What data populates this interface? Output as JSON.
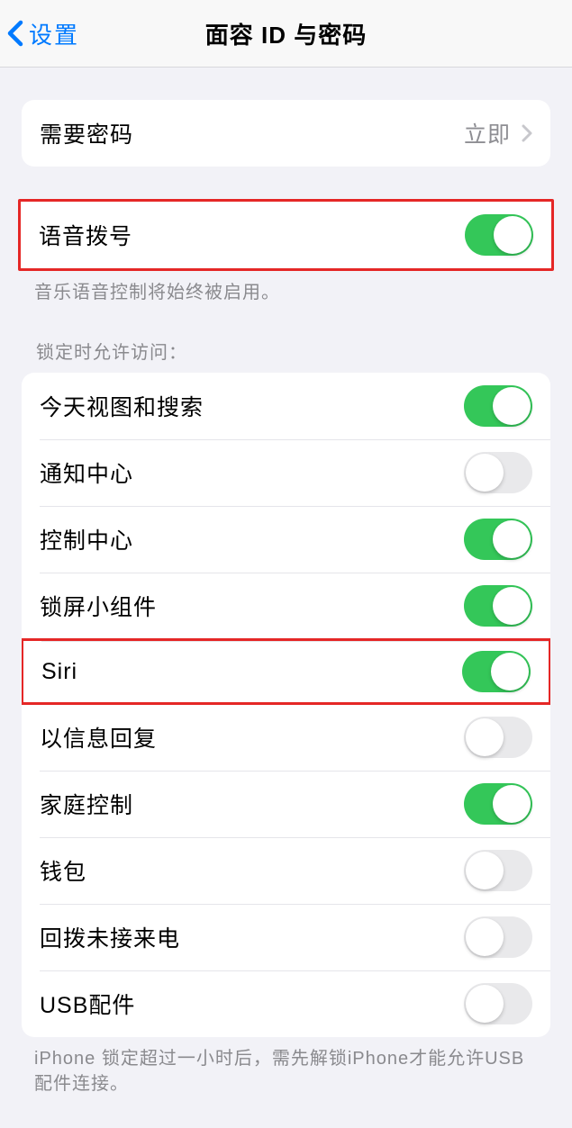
{
  "header": {
    "back_label": "设置",
    "title": "面容 ID 与密码"
  },
  "passcode_group": {
    "require_label": "需要密码",
    "require_value": "立即"
  },
  "voice_dial": {
    "label": "语音拨号",
    "on": true,
    "footer": "音乐语音控制将始终被启用。"
  },
  "lock_section": {
    "header": "锁定时允许访问：",
    "items": [
      {
        "label": "今天视图和搜索",
        "on": true,
        "highlighted": false
      },
      {
        "label": "通知中心",
        "on": false,
        "highlighted": false
      },
      {
        "label": "控制中心",
        "on": true,
        "highlighted": false
      },
      {
        "label": "锁屏小组件",
        "on": true,
        "highlighted": false
      },
      {
        "label": "Siri",
        "on": true,
        "highlighted": true
      },
      {
        "label": "以信息回复",
        "on": false,
        "highlighted": false
      },
      {
        "label": "家庭控制",
        "on": true,
        "highlighted": false
      },
      {
        "label": "钱包",
        "on": false,
        "highlighted": false
      },
      {
        "label": "回拨未接来电",
        "on": false,
        "highlighted": false
      },
      {
        "label": "USB配件",
        "on": false,
        "highlighted": false
      }
    ],
    "footer": "iPhone 锁定超过一小时后，需先解锁iPhone才能允许USB 配件连接。"
  }
}
